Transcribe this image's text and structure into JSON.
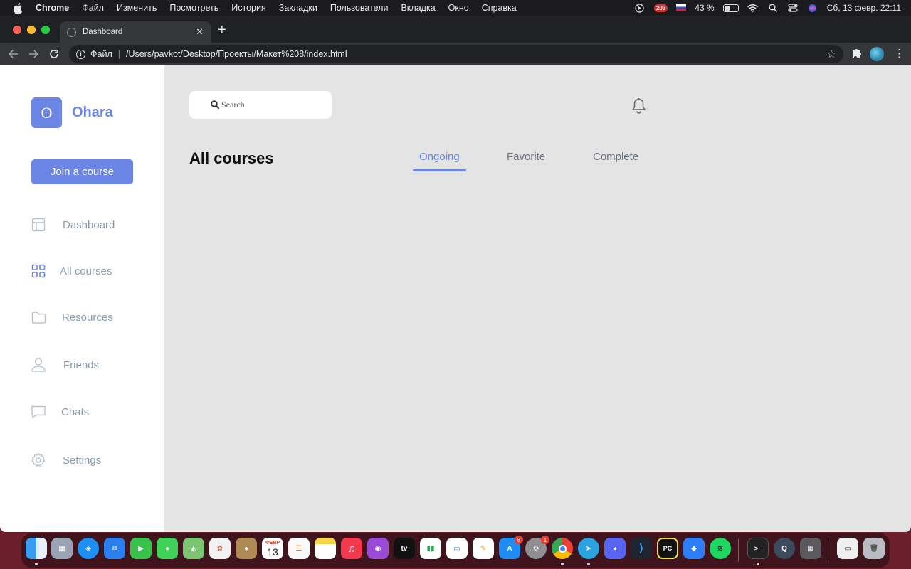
{
  "menubar": {
    "items": [
      "Chrome",
      "Файл",
      "Изменить",
      "Посмотреть",
      "История",
      "Закладки",
      "Пользователи",
      "Вкладка",
      "Окно",
      "Справка"
    ],
    "badge": "203",
    "battery": "43 %",
    "datetime": "Сб, 13 февр.  22:11"
  },
  "browser": {
    "tab_title": "Dashboard",
    "omnibox_scheme": "Файл",
    "url": "/Users/pavkot/Desktop/Проекты/Макет%208/index.html"
  },
  "sidebar": {
    "logo_letter": "O",
    "brand": "Ohara",
    "join_label": "Join a course",
    "items": [
      {
        "label": "Dashboard",
        "icon": "layout-icon"
      },
      {
        "label": "All courses",
        "icon": "grid-icon"
      },
      {
        "label": "Resources",
        "icon": "folder-icon"
      },
      {
        "label": "Friends",
        "icon": "user-icon"
      },
      {
        "label": "Chats",
        "icon": "chat-icon"
      },
      {
        "label": "Settings",
        "icon": "gear-icon"
      }
    ]
  },
  "main": {
    "search_placeholder": "Search",
    "title": "All courses",
    "tabs": [
      "Ongoing",
      "Favorite",
      "Complete"
    ],
    "active_tab": "Ongoing"
  },
  "dock": {
    "calendar_month": "ФЕВР",
    "calendar_day": "13",
    "appstore_badge": "8",
    "settings_badge": "1"
  },
  "colors": {
    "accent": "#6c86e6",
    "sidebar_text": "#8a9bb0",
    "page_bg": "#e4e4e4"
  }
}
